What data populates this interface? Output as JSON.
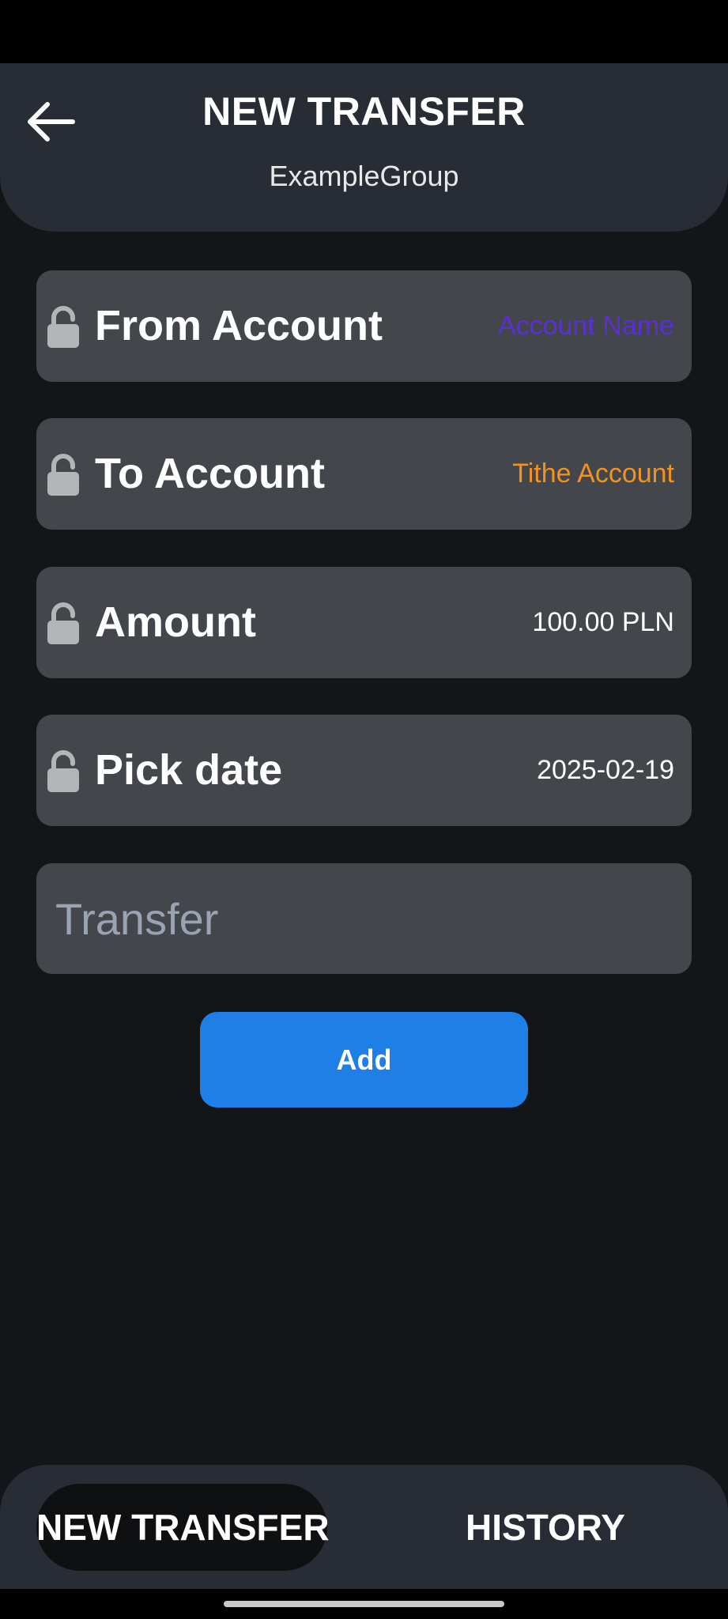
{
  "header": {
    "title": "NEW TRANSFER",
    "subtitle": "ExampleGroup",
    "back_icon": "arrow-left-icon"
  },
  "fields": [
    {
      "label": "From Account",
      "value": "Account Name",
      "value_color": "#5b2fd6",
      "icon": "lock-icon"
    },
    {
      "label": "To Account",
      "value": "Tithe Account",
      "value_color": "#f2921f",
      "icon": "lock-icon"
    },
    {
      "label": "Amount",
      "value": "100.00 PLN",
      "value_color": "#ffffff",
      "icon": "lock-icon"
    },
    {
      "label": "Pick date",
      "value": "2025-02-19",
      "value_color": "#ffffff",
      "icon": "lock-icon"
    }
  ],
  "transfer_input": {
    "placeholder": "Transfer",
    "value": ""
  },
  "add_button": {
    "label": "Add",
    "color": "#1e7fe6"
  },
  "bottom_nav": {
    "tabs": [
      {
        "label": "NEW TRANSFER",
        "active": true
      },
      {
        "label": "HISTORY",
        "active": false
      }
    ]
  },
  "colors": {
    "background": "#141518",
    "header": "#282d35",
    "field": "#43464b",
    "accent": "#1e7fe6"
  }
}
